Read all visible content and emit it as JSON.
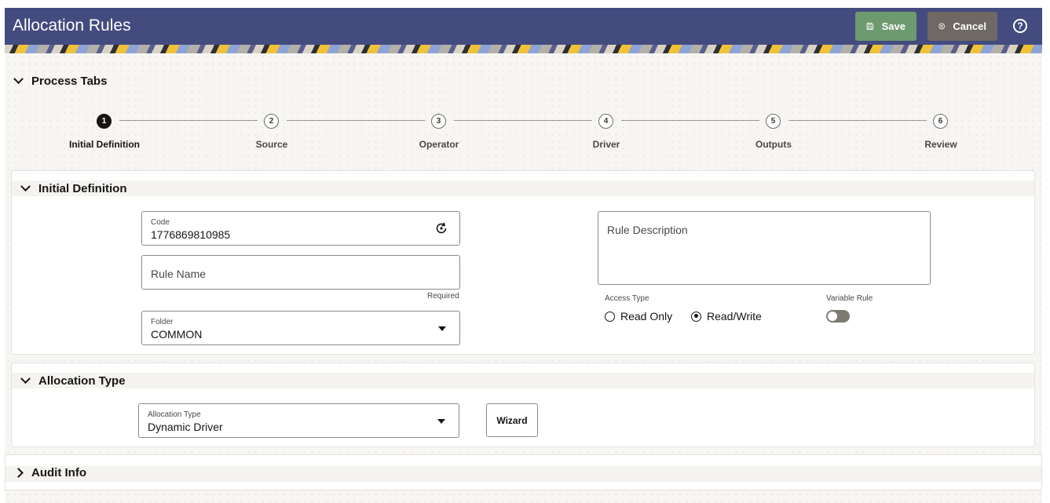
{
  "header": {
    "title": "Allocation Rules",
    "save_label": "Save",
    "cancel_label": "Cancel",
    "help_glyph": "?"
  },
  "process_tabs": {
    "title": "Process Tabs",
    "steps": [
      {
        "number": "1",
        "label": "Initial Definition"
      },
      {
        "number": "2",
        "label": "Source"
      },
      {
        "number": "3",
        "label": "Operator"
      },
      {
        "number": "4",
        "label": "Driver"
      },
      {
        "number": "5",
        "label": "Outputs"
      },
      {
        "number": "6",
        "label": "Review"
      }
    ],
    "active_step": 1
  },
  "initial_definition": {
    "title": "Initial Definition",
    "code_label": "Code",
    "code_value": "1776869810985",
    "rule_name_placeholder": "Rule Name",
    "required_text": "Required",
    "folder_label": "Folder",
    "folder_value": "COMMON",
    "rule_description_placeholder": "Rule Description",
    "access_type_label": "Access Type",
    "access_options": [
      "Read Only",
      "Read/Write"
    ],
    "access_selected": "Read/Write",
    "variable_rule_label": "Variable Rule",
    "variable_rule_on": false
  },
  "allocation_type": {
    "title": "Allocation Type",
    "field_label": "Allocation Type",
    "field_value": "Dynamic Driver",
    "wizard_label": "Wizard"
  },
  "audit_info": {
    "title": "Audit Info"
  },
  "colors": {
    "header_bg": "#434b7f",
    "save_bg": "#6d9a6f",
    "cancel_bg": "#6f6963"
  }
}
